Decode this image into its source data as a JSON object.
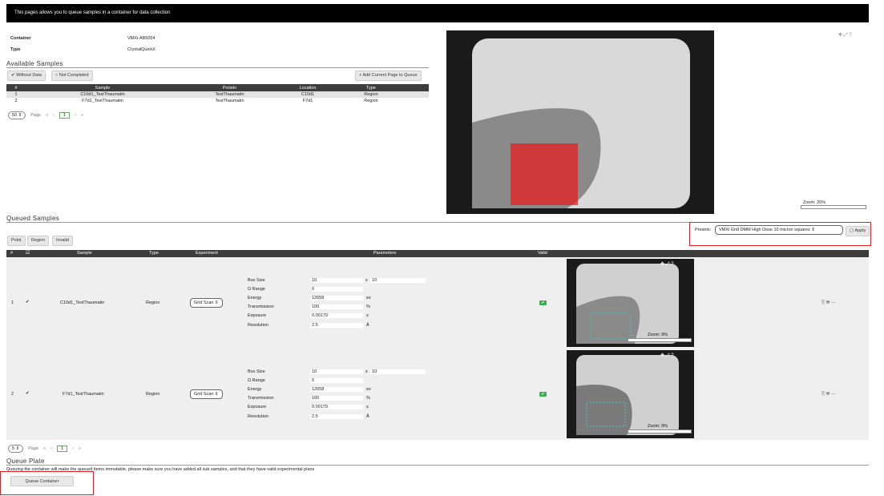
{
  "banner": {
    "text": "This pages allows you to queue samples in a container for data collection"
  },
  "container": {
    "container_label": "Container",
    "container_value": "VMXi-AB5054",
    "type_label": "Type",
    "type_value": "CrystalQuickX"
  },
  "available": {
    "title": "Available Samples",
    "filter_without_data": "Without Data",
    "filter_not_completed": "Not Completed",
    "add_page_button": "Add Current Page to Queue",
    "headers": [
      "#",
      "Sample",
      "Protein",
      "Location",
      "Type"
    ],
    "rows": [
      [
        "1",
        "C10d1_TestThaumatin",
        "TestThaumatin",
        "C10d1",
        "Region"
      ],
      [
        "2",
        "F7d1_TestThaumatin",
        "TestThaumatin",
        "F7d1",
        "Region"
      ]
    ],
    "per_page": "50",
    "page_label": "Page",
    "page": "1"
  },
  "viewer": {
    "zoom": "Zoom: 20%"
  },
  "queued": {
    "title": "Queued Samples",
    "filters": [
      "Point",
      "Region",
      "Invalid"
    ],
    "presets_label": "Presets:",
    "preset_value": "VMXi Grid DMM High Dose 10 micron squares",
    "apply_button": "Apply",
    "headers": [
      "#",
      "Sample",
      "Type",
      "Experiment",
      "Parameters",
      "Valid"
    ],
    "param_labels": [
      "Box Size",
      "Ω Range",
      "Energy",
      "Transmission",
      "Exposure",
      "Resolution"
    ],
    "rows": [
      {
        "num": "1",
        "sample": "C10d1_TestThaumatin",
        "type": "Region",
        "experiment": "Grid Scan",
        "box_w": "10",
        "box_h": "10",
        "omega": "0",
        "energy": "12658",
        "transmission": "100",
        "exposure": "0.00179",
        "resolution": "2.5",
        "zoom": "Zoom: 9%"
      },
      {
        "num": "2",
        "sample": "F7d1_TestThaumatin",
        "type": "Region",
        "experiment": "Grid Scan",
        "box_w": "10",
        "box_h": "10",
        "omega": "0",
        "energy": "12658",
        "transmission": "100",
        "exposure": "0.00179",
        "resolution": "2.5",
        "zoom": "Zoom: 9%"
      }
    ],
    "units": {
      "box": "x",
      "energy": "ev",
      "transmission": "%",
      "exposure": "s",
      "resolution": "Å"
    },
    "per_page": "5",
    "page_label": "Page",
    "page": "1"
  },
  "plate": {
    "title": "Queue Plate",
    "notice": "Queuing the container will make the queued items immutable, please make sure you have added all sub samples, and that they have valid experimental plans",
    "queue_button": "Queue Container"
  },
  "colors": {
    "red_highlight": "#e02020",
    "valid_green": "#3ab24a",
    "header_dark": "#3d3d3d"
  }
}
